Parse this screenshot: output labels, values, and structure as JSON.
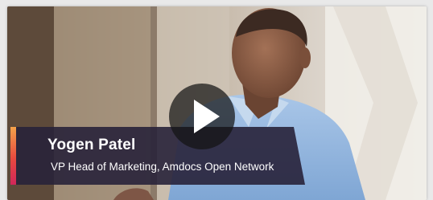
{
  "video": {
    "presenter_name": "Yogen Patel",
    "presenter_title": "VP Head of Marketing, Amdocs Open Network",
    "play_icon": "play-icon",
    "accent_colors": [
      "#f4a24a",
      "#e8493f",
      "#d0275a"
    ],
    "lower_third_color": "#28223a"
  }
}
